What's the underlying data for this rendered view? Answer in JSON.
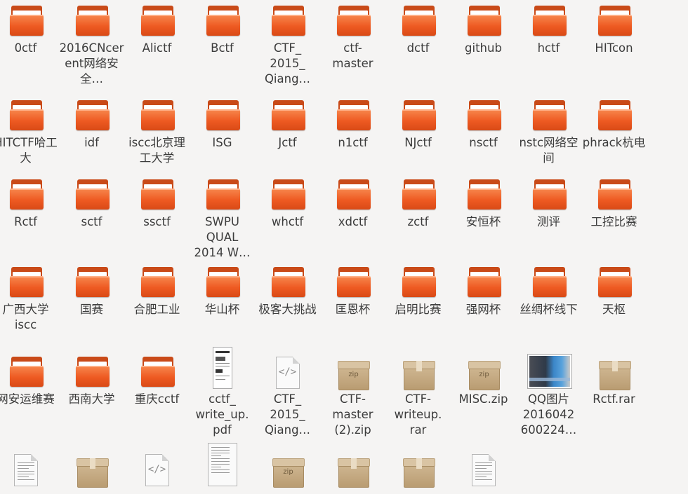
{
  "items": [
    {
      "label": "0ctf",
      "type": "folder"
    },
    {
      "label": "2016CNcerent网络安全…",
      "type": "folder"
    },
    {
      "label": "Alictf",
      "type": "folder"
    },
    {
      "label": "Bctf",
      "type": "folder"
    },
    {
      "label": "CTF_\n2015_\nQiang…",
      "type": "folder"
    },
    {
      "label": "ctf-\nmaster",
      "type": "folder"
    },
    {
      "label": "dctf",
      "type": "folder"
    },
    {
      "label": "github",
      "type": "folder"
    },
    {
      "label": "hctf",
      "type": "folder"
    },
    {
      "label": "HITcon",
      "type": "folder"
    },
    {
      "label": "HITCTF哈工大",
      "type": "folder"
    },
    {
      "label": "idf",
      "type": "folder"
    },
    {
      "label": "iscc北京理工大学",
      "type": "folder"
    },
    {
      "label": "ISG",
      "type": "folder"
    },
    {
      "label": "Jctf",
      "type": "folder"
    },
    {
      "label": "n1ctf",
      "type": "folder"
    },
    {
      "label": "NJctf",
      "type": "folder"
    },
    {
      "label": "nsctf",
      "type": "folder"
    },
    {
      "label": "nstc网络空间",
      "type": "folder"
    },
    {
      "label": "phrack杭电",
      "type": "folder"
    },
    {
      "label": "Rctf",
      "type": "folder"
    },
    {
      "label": "sctf",
      "type": "folder"
    },
    {
      "label": "ssctf",
      "type": "folder"
    },
    {
      "label": "SWPU\nQUAL\n2014 W…",
      "type": "folder"
    },
    {
      "label": "whctf",
      "type": "folder"
    },
    {
      "label": "xdctf",
      "type": "folder"
    },
    {
      "label": "zctf",
      "type": "folder"
    },
    {
      "label": "安恒杯",
      "type": "folder"
    },
    {
      "label": "测评",
      "type": "folder"
    },
    {
      "label": "工控比赛",
      "type": "folder"
    },
    {
      "label": "广西大学iscc",
      "type": "folder"
    },
    {
      "label": "国赛",
      "type": "folder"
    },
    {
      "label": "合肥工业",
      "type": "folder"
    },
    {
      "label": "华山杯",
      "type": "folder"
    },
    {
      "label": "极客大挑战",
      "type": "folder"
    },
    {
      "label": "匡恩杯",
      "type": "folder"
    },
    {
      "label": "启明比赛",
      "type": "folder"
    },
    {
      "label": "强网杯",
      "type": "folder"
    },
    {
      "label": "丝绸杯线下",
      "type": "folder"
    },
    {
      "label": "天枢",
      "type": "folder"
    },
    {
      "label": "网安运维赛",
      "type": "folder"
    },
    {
      "label": "西南大学",
      "type": "folder"
    },
    {
      "label": "重庆cctf",
      "type": "folder"
    },
    {
      "label": "cctf_\nwrite_up.\npdf",
      "type": "pdf"
    },
    {
      "label": "CTF_\n2015_\nQiang…",
      "type": "html"
    },
    {
      "label": "CTF-\nmaster\n(2).zip",
      "type": "zip"
    },
    {
      "label": "CTF-\nwriteup.\nrar",
      "type": "box"
    },
    {
      "label": "MISC.zip",
      "type": "zip"
    },
    {
      "label": "QQ图片\n2016042\n600224…",
      "type": "image"
    },
    {
      "label": "Rctf.rar",
      "type": "box"
    },
    {
      "label": "",
      "type": "text"
    },
    {
      "label": "",
      "type": "box"
    },
    {
      "label": "",
      "type": "html"
    },
    {
      "label": "",
      "type": "doc"
    },
    {
      "label": "",
      "type": "zip"
    },
    {
      "label": "",
      "type": "box"
    },
    {
      "label": "",
      "type": "box"
    },
    {
      "label": "",
      "type": "text"
    }
  ]
}
